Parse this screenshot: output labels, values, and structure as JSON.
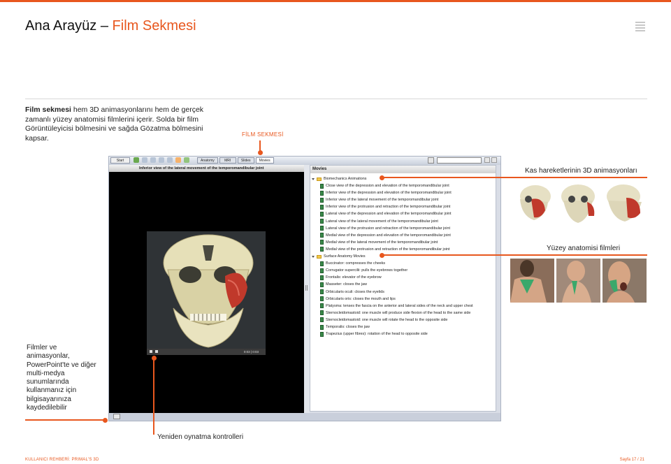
{
  "header": {
    "title_main": "Ana Arayüz – ",
    "title_accent": "Film Sekmesi"
  },
  "intro": {
    "bold": "Film sekmesi",
    "text": " hem 3D animasyonlarını hem de gerçek zamanlı yüzey anatomisi filmlerini içerir. Solda bir film Görüntüleyicisi bölmesini ve sağda Gözatma bölmesini kapsar."
  },
  "film_tab_label": "FİLM SEKMESİ",
  "app": {
    "start_label": "Start",
    "tabs": [
      {
        "label": "Anatomy"
      },
      {
        "label": "MRI"
      },
      {
        "label": "Slides"
      },
      {
        "label": "Movies"
      }
    ],
    "viewer_title": "Inferior view of the lateral movement of the temporomandibular joint",
    "time_display": "0:03 | 0:03",
    "browser_title": "Movies",
    "tree": [
      {
        "type": "cat",
        "label": "Biomechanics Animations"
      },
      {
        "type": "item",
        "label": "Close view of the depression and elevation of the temporomandibular joint"
      },
      {
        "type": "item",
        "label": "Inferior view of the depression and elevation of the temporomandibular joint"
      },
      {
        "type": "item",
        "label": "Inferior view of the lateral movement of the temporomandibular joint"
      },
      {
        "type": "item",
        "label": "Inferior view of the protrusion and retraction of the temporomandibular joint"
      },
      {
        "type": "item",
        "label": "Lateral view of the depression and elevation of the temporomandibular joint"
      },
      {
        "type": "item",
        "label": "Lateral view of the lateral movement of the temporomandibular joint"
      },
      {
        "type": "item",
        "label": "Lateral view of the protrusion and retraction of the temporomandibular joint"
      },
      {
        "type": "item",
        "label": "Medial view of the depression and elevation of the temporomandibular joint"
      },
      {
        "type": "item",
        "label": "Medial view of the lateral movement of the temporomandibular joint"
      },
      {
        "type": "item",
        "label": "Medial view of the protrusion and retraction of the temporomandibular joint"
      },
      {
        "type": "cat",
        "label": "Surface Anatomy Movies"
      },
      {
        "type": "item",
        "label": "Buccinator: compresses the cheeks"
      },
      {
        "type": "item",
        "label": "Corrugator supercilii: pulls the eyebrows together"
      },
      {
        "type": "item",
        "label": "Frontalis: elevator of the eyebrow"
      },
      {
        "type": "item",
        "label": "Masseter: closes the jaw"
      },
      {
        "type": "item",
        "label": "Orbicularis oculi: closes the eyelids"
      },
      {
        "type": "item",
        "label": "Orbicularis oris: closes the mouth and lips"
      },
      {
        "type": "item",
        "label": "Platysma: tenses the fascia on the anterior and lateral sides of the neck and upper chest"
      },
      {
        "type": "item",
        "label": "Sternocleidomastoid: one muscle will produce side flexion of the head to the same side"
      },
      {
        "type": "item",
        "label": "Sternocleidomastoid: one muscle will rotate the head to the opposite side"
      },
      {
        "type": "item",
        "label": "Temporalis: closes the jaw"
      },
      {
        "type": "item",
        "label": "Trapezius (upper fibres): rotation of the head to opposite side"
      }
    ]
  },
  "annotations": {
    "kas": "Kas hareketlerinin 3D animasyonları",
    "yuzey": "Yüzey anatomisi filmleri",
    "filmler": "Filmler ve animasyonlar, PowerPoint'te ve diğer multi-medya sunumlarında kullanmanız için bilgisayarınıza kaydedilebilir",
    "yeniden": "Yeniden oynatma kontrolleri"
  },
  "footer": {
    "left": "KULLANICI REHBERİ: PRIMAL'S 3D",
    "right": "Sayfa 17 / 21"
  },
  "colors": {
    "accent": "#e8571e"
  }
}
